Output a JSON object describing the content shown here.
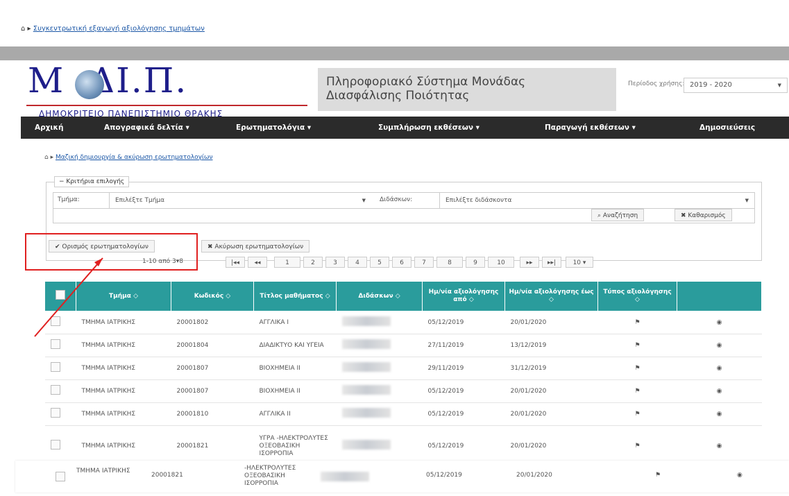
{
  "outer_breadcrumb": {
    "home_icon": "home-icon",
    "sep": "▸",
    "link": "Συγκεντρωτική εξαγωγή αξιολόγησης τμημάτων"
  },
  "logo": {
    "letters": "Μ  .ΔΙ.Π.",
    "university": "ΔΗΜΟΚΡΙΤΕΙΟ ΠΑΝΕΠΙΣΤΗΜΙΟ ΘΡΑΚΗΣ"
  },
  "system_title": {
    "line1": "Πληροφοριακό Σύστημα Μονάδας",
    "line2": "Διασφάλισης Ποιότητας"
  },
  "period": {
    "label": "Περίοδος χρήσης:",
    "value": "2019 - 2020"
  },
  "nav": [
    {
      "label": "Αρχική",
      "x": 0
    },
    {
      "label": "Απογραφικά δελτία ▾"
    },
    {
      "label": "Ερωτηματολόγια ▾"
    },
    {
      "label": "Συμπλήρωση εκθέσεων ▾"
    },
    {
      "label": "Παραγωγή εκθέσεων ▾"
    },
    {
      "label": "Δημοσιεύσεις"
    }
  ],
  "inner_breadcrumb": {
    "sep": "▸",
    "link": "Μαζική δημιουργία & ακύρωση ερωτηματολογίων"
  },
  "filter": {
    "legend": "− Κριτήρια επιλογής",
    "dept_label": "Τμήμα:",
    "dept_placeholder": "Επιλέξτε Τμήμα",
    "teacher_label": "Διδάσκων:",
    "teacher_placeholder": "Επιλέξτε διδάσκοντα",
    "search_btn": "⌕ Αναζήτηση",
    "clear_btn": "✖ Καθαρισμός"
  },
  "actions": {
    "assign": "✔ Ορισμός ερωτηματολογίων",
    "cancel": "✖ Ακύρωση ερωτηματολογίων"
  },
  "pager": {
    "info": "1-10 από 3▾8",
    "first": "|◂◂",
    "prev": "◂◂",
    "pages": [
      "1",
      "2",
      "3",
      "4",
      "5",
      "6",
      "7",
      "8",
      "9",
      "10"
    ],
    "next": "▸▸",
    "last": "▸▸|",
    "size": "10 ▾"
  },
  "table": {
    "headers": [
      "",
      "Τμήμα ◇",
      "Κωδικός ◇",
      "Τίτλος μαθήματος ◇",
      "Διδάσκων ◇",
      "Ημ/νία αξιολόγησης από ◇",
      "Ημ/νία αξιολόγησης έως ◇",
      "Τύπος αξιολόγησης ◇",
      ""
    ],
    "rows": [
      {
        "dept": "ΤΜΗΜΑ ΙΑΤΡΙΚΗΣ",
        "code": "20001802",
        "title": "ΑΓΓΛΙΚΑ I",
        "from": "05/12/2019",
        "to": "20/01/2020",
        "type": "⚑",
        "view": "◉"
      },
      {
        "dept": "ΤΜΗΜΑ ΙΑΤΡΙΚΗΣ",
        "code": "20001804",
        "title": "ΔΙΑΔΙΚΤΥΟ ΚΑΙ ΥΓΕΙΑ",
        "from": "27/11/2019",
        "to": "13/12/2019",
        "type": "⚑",
        "view": "◉"
      },
      {
        "dept": "ΤΜΗΜΑ ΙΑΤΡΙΚΗΣ",
        "code": "20001807",
        "title": "ΒΙΟΧΗΜΕΙΑ II",
        "from": "29/11/2019",
        "to": "31/12/2019",
        "type": "⚑",
        "view": "◉"
      },
      {
        "dept": "ΤΜΗΜΑ ΙΑΤΡΙΚΗΣ",
        "code": "20001807",
        "title": "ΒΙΟΧΗΜΕΙΑ II",
        "from": "05/12/2019",
        "to": "20/01/2020",
        "type": "⚑",
        "view": "◉"
      },
      {
        "dept": "ΤΜΗΜΑ ΙΑΤΡΙΚΗΣ",
        "code": "20001810",
        "title": "ΑΓΓΛΙΚΑ II",
        "from": "05/12/2019",
        "to": "20/01/2020",
        "type": "⚑",
        "view": "◉"
      },
      {
        "dept": "ΤΜΗΜΑ ΙΑΤΡΙΚΗΣ",
        "code": "20001821",
        "title": "ΥΓΡΑ -ΗΛΕΚΤΡΟΛΥΤΕΣ ΟΞΕΟΒΑΣΙΚΗ ΙΣΟΡΡΟΠΙΑ",
        "from": "05/12/2019",
        "to": "20/01/2020",
        "type": "⚑",
        "view": "◉"
      }
    ]
  },
  "overlay_row": {
    "dept": "ΤΜΗΜΑ ΙΑΤΡΙΚΗΣ",
    "code": "20001821",
    "title": "-ΗΛΕΚΤΡΟΛΥΤΕΣ ΟΞΕΟΒΑΣΙΚΗ ΙΣΟΡΡΟΠΙΑ",
    "from": "05/12/2019",
    "to": "20/01/2020",
    "type": "⚑",
    "view": "◉"
  },
  "colors": {
    "teal": "#2a9c9c",
    "nav": "#2b2b2b",
    "annotation": "#e02020"
  }
}
